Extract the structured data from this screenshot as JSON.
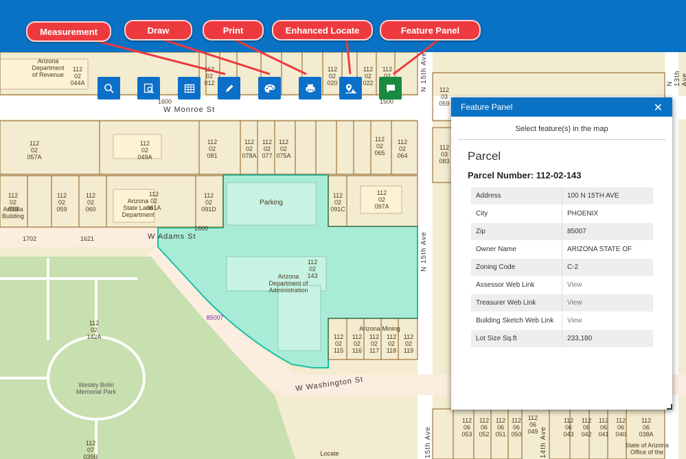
{
  "callouts": {
    "measurement": "Measurement",
    "draw": "Draw",
    "print": "Print",
    "enhanced_locate": "Enhanced Locate",
    "feature_panel": "Feature Panel"
  },
  "map": {
    "streets": {
      "monroe": "W Monroe St",
      "adams": "W Adams St",
      "washington": "W Washington St",
      "15th_ave_top": "N 15th Ave",
      "15th_ave_mid": "N 15th Ave",
      "13th_ave": "N 13th Ave",
      "15th_ave_bottom": "15th Ave",
      "14th_ave_bottom": "14th Ave"
    },
    "labels": {
      "dept_revenue": "Arizona\nDepartment\nof Revenue",
      "state_land": "Arizona\nState Land\nDepartment",
      "arizona_state_bldg": "Ar058a\nBuilding",
      "parking": "Parking",
      "dept_admin": "Arizona\nDepartment of\nAdministration",
      "parcel_selected": "112\n02\n143",
      "mining": "Arizona Mining",
      "wesley": "Wesley Bolin\nMemorial Park",
      "state_office": "State of Arizona\nOffice of the",
      "zip": "85007",
      "p044a": "112\n02\n044A",
      "p057a": "112\n02\n057A",
      "p049a": "112\n02\n049A",
      "p081": "112\n02\n081",
      "p078a": "112\n02\n078A",
      "p077": "112\n02\n077",
      "p075a": "112\n02\n075A",
      "p065": "112\n02\n065",
      "p064": "112\n02\n064",
      "p059": "112\n02\n059",
      "p060": "112\n02\n060",
      "p061a": "112\n02\n061A",
      "p091d": "112\n02\n091D",
      "p091c": "112\n02\n091C",
      "p097a": "112\n02\n097A",
      "p142a": "112\n02\n142A",
      "p115": "112\n02\n115",
      "p116": "112\n02\n116",
      "p117": "112\n02\n117",
      "p118": "112\n02\n118",
      "p119": "112\n02\n119",
      "p039b": "112\n07\n039B",
      "p020": "112\n02\n020",
      "p022": "112\n02\n022",
      "p024": "112\n02\n024",
      "p012": "112\n02\n012",
      "p083": "112\n03\n083",
      "p059b": "112\n03\n059",
      "p053": "112\n06\n053",
      "p052": "112\n06\n052",
      "p051": "112\n06\n051",
      "p050": "112\n06\n050",
      "p049": "112\n06\n049",
      "p043": "112\n06\n043",
      "p042": "112\n06\n042",
      "p041": "112\n06\n041",
      "p040": "112\n06\n040",
      "p038a": "112\n06\n038A",
      "locate": "Locate",
      "num1702": "1702",
      "num1621": "1621",
      "num1600a": "1600",
      "num1600b": "1600",
      "num1500": "1500"
    }
  },
  "panel": {
    "title": "Feature Panel",
    "hint": "Select feature(s) in the map",
    "section": "Parcel",
    "parcel_number": "Parcel Number: 112-02-143",
    "rows": [
      {
        "key": "Address",
        "value": "100 N 15TH AVE"
      },
      {
        "key": "City",
        "value": "PHOENIX"
      },
      {
        "key": "Zip",
        "value": "85007"
      },
      {
        "key": "Owner Name",
        "value": "ARIZONA STATE OF"
      },
      {
        "key": "Zoning Code",
        "value": "C-2"
      },
      {
        "key": "Assessor Web Link",
        "value": "View"
      },
      {
        "key": "Treasurer Web Link",
        "value": "View"
      },
      {
        "key": "Building Sketch Web Link",
        "value": "View"
      },
      {
        "key": "Lot Size Sq.ft",
        "value": "233,180"
      }
    ]
  },
  "colors": {
    "topbar": "#0a72c4",
    "callout": "#ed3a3f",
    "parcel_fill": "#a8ecd8",
    "parcel_line": "#1dbfa2",
    "street": "#ffffff",
    "lot_line": "#8a5a20"
  },
  "tools": [
    "search-tool-icon",
    "select-tool-icon",
    "table-icon",
    "pencil-icon",
    "palette-icon",
    "printer-icon",
    "locate-icon",
    "comment-icon"
  ]
}
